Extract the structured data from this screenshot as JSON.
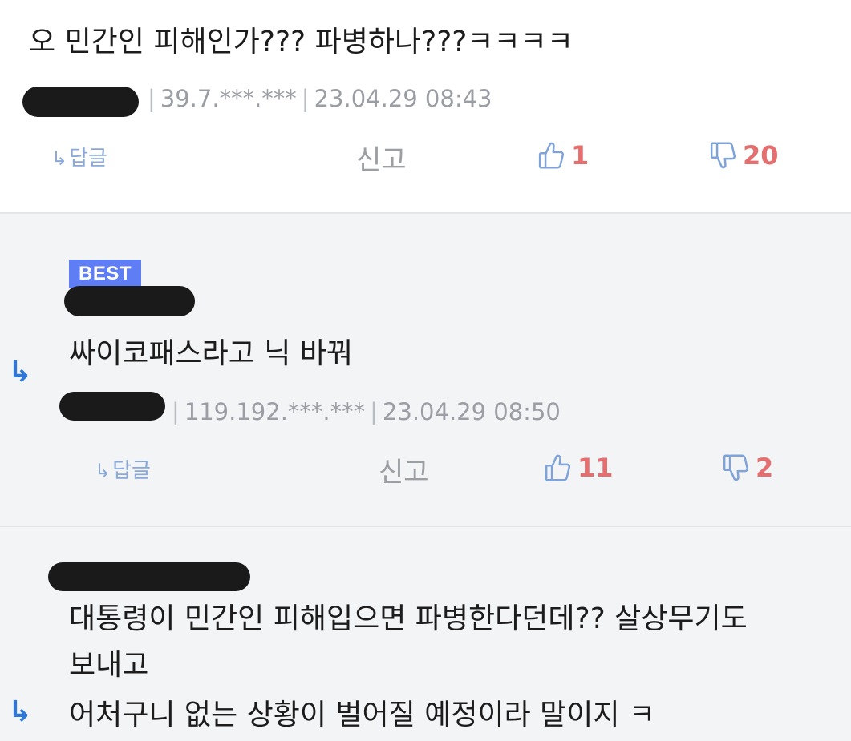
{
  "comments": [
    {
      "text": "오 민간인 피해인가??? 파병하나???ㅋㅋㅋㅋ",
      "ip": "39.7.***.***",
      "date": "23.04.29 08:43",
      "reply_label": "답글",
      "report_label": "신고",
      "likes": "1",
      "dislikes": "20"
    },
    {
      "badge": "BEST",
      "text": "싸이코패스라고 닉 바꿔",
      "ip": "119.192.***.***",
      "date": "23.04.29 08:50",
      "reply_label": "답글",
      "report_label": "신고",
      "likes": "11",
      "dislikes": "2"
    },
    {
      "text_line1": "대통령이 민간인 피해입으면 파병한다던데?? 살상무기도",
      "text_line2": "보내고",
      "text_line3": "어처구니 없는 상황이 벌어질 예정이라 말이지 ㅋ"
    }
  ],
  "icons": {
    "reply": "reply-arrow-icon",
    "like": "thumbs-up-icon",
    "dislike": "thumbs-down-icon"
  },
  "colors": {
    "like_count": "#e56f6f",
    "thumb_outline": "#7fa3d9",
    "best_badge": "#5f7ef5",
    "reply_arrow": "#2f78d8"
  }
}
